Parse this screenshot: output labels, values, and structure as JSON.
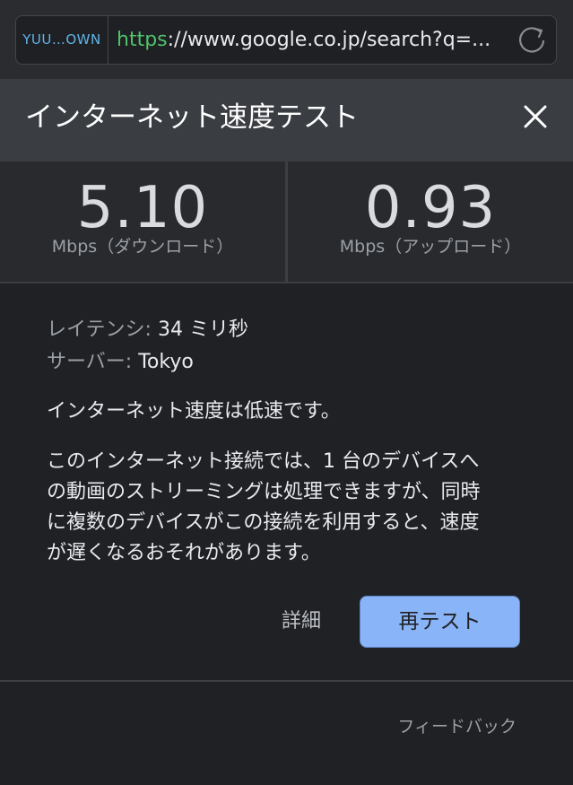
{
  "browser": {
    "tag": "YUU…OWN",
    "url_scheme": "https",
    "url_rest": "://www.google.co.jp/search?q=..."
  },
  "panel": {
    "title": "インターネット速度テスト"
  },
  "speed": {
    "download_value": "5.10",
    "download_unit": "Mbps（ダウンロード）",
    "upload_value": "0.93",
    "upload_unit": "Mbps（アップロード）"
  },
  "info": {
    "latency_label": "レイテンシ:",
    "latency_value": "34 ミリ秒",
    "server_label": "サーバー:",
    "server_value": "Tokyo"
  },
  "summary": "インターネット速度は低速です。",
  "description_lines": [
    "このインターネット接続では、1 台のデバイスへ",
    "の動画のストリーミングは処理できますが、同時",
    "に複数のデバイスがこの接続を利用すると、速度",
    "が遅くなるおそれがあります。"
  ],
  "actions": {
    "details_label": "詳細",
    "retest_label": "再テスト"
  },
  "footer": {
    "feedback_label": "フィードバック"
  },
  "colors": {
    "accent": "#8ab4f8",
    "background": "#202124",
    "header": "#3a3d42",
    "url_scheme": "#4fc26b"
  },
  "icons": {
    "reload": "reload-icon",
    "close": "close-icon"
  }
}
